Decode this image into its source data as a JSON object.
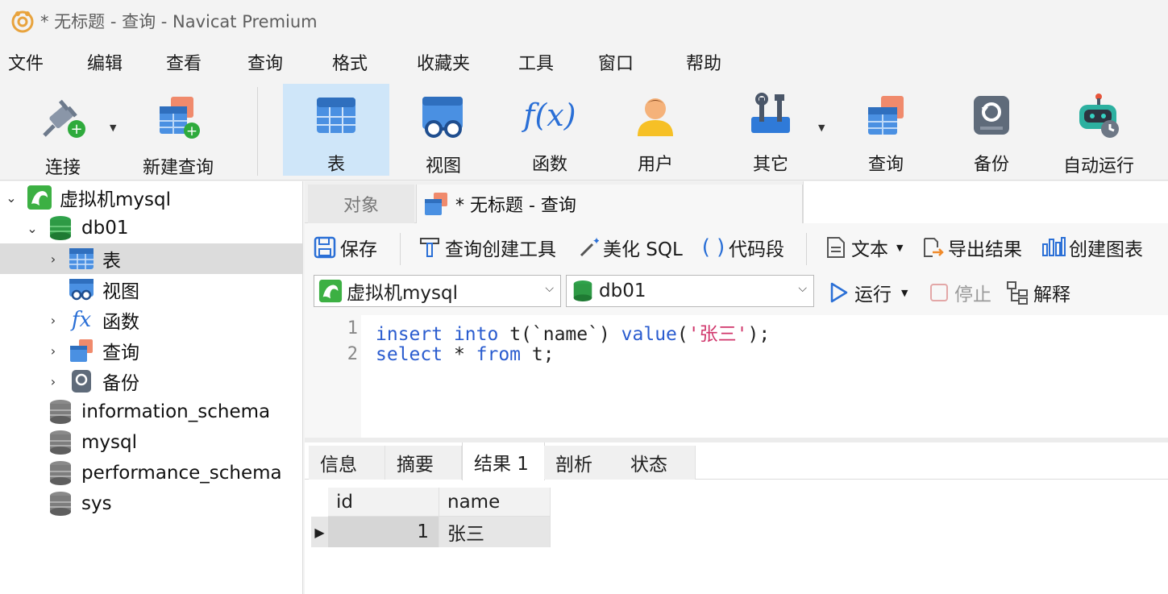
{
  "window": {
    "title": "* 无标题 - 查询 - Navicat Premium"
  },
  "menu": [
    "文件",
    "编辑",
    "查看",
    "查询",
    "格式",
    "收藏夹",
    "工具",
    "窗口",
    "帮助"
  ],
  "toolbar": {
    "connect": "连接",
    "new_query": "新建查询",
    "table": "表",
    "view": "视图",
    "function": "函数",
    "user": "用户",
    "other": "其它",
    "query": "查询",
    "backup": "备份",
    "automation": "自动运行",
    "function_icon_text": "f(x)"
  },
  "sidebar": {
    "connection": "虚拟机mysql",
    "database": "db01",
    "children": [
      "表",
      "视图",
      "函数",
      "查询",
      "备份"
    ],
    "other_dbs": [
      "information_schema",
      "mysql",
      "performance_schema",
      "sys"
    ],
    "selected": "表"
  },
  "tabs": {
    "objects": "对象",
    "query_tab": "* 无标题 - 查询"
  },
  "query_toolbar": {
    "save": "保存",
    "query_builder": "查询创建工具",
    "beautify": "美化 SQL",
    "snippet": "代码段",
    "text": "文本",
    "export": "导出结果",
    "chart": "创建图表",
    "snippet_icon": "( )"
  },
  "conn_bar": {
    "connection": "虚拟机mysql",
    "database": "db01",
    "run": "运行",
    "stop": "停止",
    "explain": "解释"
  },
  "editor": {
    "lines": [
      {
        "num": "1",
        "kw1": "insert",
        "sp1": " ",
        "kw2": "into",
        "mid": " t(`name`) ",
        "kw3": "value",
        "open": "(",
        "str": "'张三'",
        "close": ");"
      },
      {
        "num": "2",
        "kw1": "select",
        "sp1": " * ",
        "kw2": "from",
        "mid": " t;"
      }
    ]
  },
  "result_tabs": [
    "信息",
    "摘要",
    "结果 1",
    "剖析",
    "状态"
  ],
  "result": {
    "columns": [
      "id",
      "name"
    ],
    "rows": [
      [
        "1",
        "张三"
      ]
    ]
  },
  "colors": {
    "accent": "#2a5ccf",
    "string": "#d0366b",
    "active_toolbar": "#cfe6f9",
    "mysql_green": "#3cb043"
  }
}
